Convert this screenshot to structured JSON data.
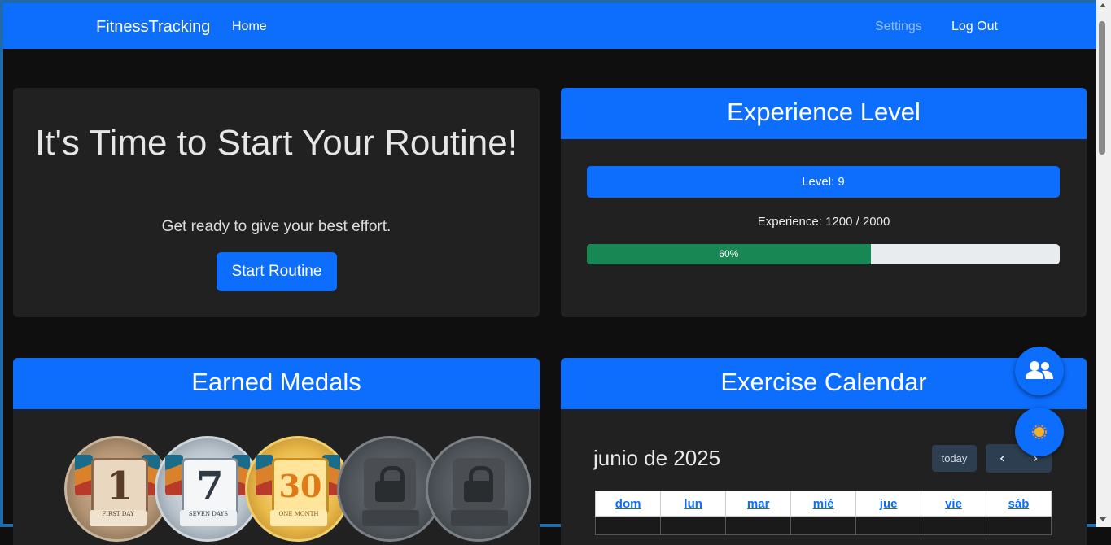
{
  "navbar": {
    "brand": "FitnessTracking",
    "home": "Home",
    "settings": "Settings",
    "logout": "Log Out"
  },
  "hero": {
    "title": "It's Time to Start Your Routine!",
    "subtitle": "Get ready to give your best effort.",
    "button": "Start Routine"
  },
  "experience": {
    "header": "Experience Level",
    "level_label": "Level: 9",
    "xp_text": "Experience: 1200 / 2000",
    "progress_label": "60%",
    "progress_percent": 60
  },
  "medals": {
    "header": "Earned Medals",
    "items": [
      {
        "number": "1",
        "caption": "FIRST DAY",
        "icon": "bronze-medal",
        "locked": false
      },
      {
        "number": "7",
        "caption": "SEVEN DAYS",
        "icon": "silver-medal",
        "locked": false
      },
      {
        "number": "30",
        "caption": "ONE MONTH",
        "icon": "gold-medal",
        "locked": false
      },
      {
        "icon": "locked-medal",
        "locked": true
      },
      {
        "icon": "locked-medal",
        "locked": true
      }
    ]
  },
  "calendar": {
    "header": "Exercise Calendar",
    "month_title": "junio de 2025",
    "today": "today",
    "weekdays": [
      "dom",
      "lun",
      "mar",
      "mié",
      "jue",
      "vie",
      "sáb"
    ]
  },
  "fab": {
    "users_icon": "users-icon",
    "theme_icon": "sun-icon"
  },
  "colors": {
    "primary": "#0d6efd",
    "success": "#198754",
    "card_bg": "#212121",
    "page_bg": "#0f0f10"
  }
}
